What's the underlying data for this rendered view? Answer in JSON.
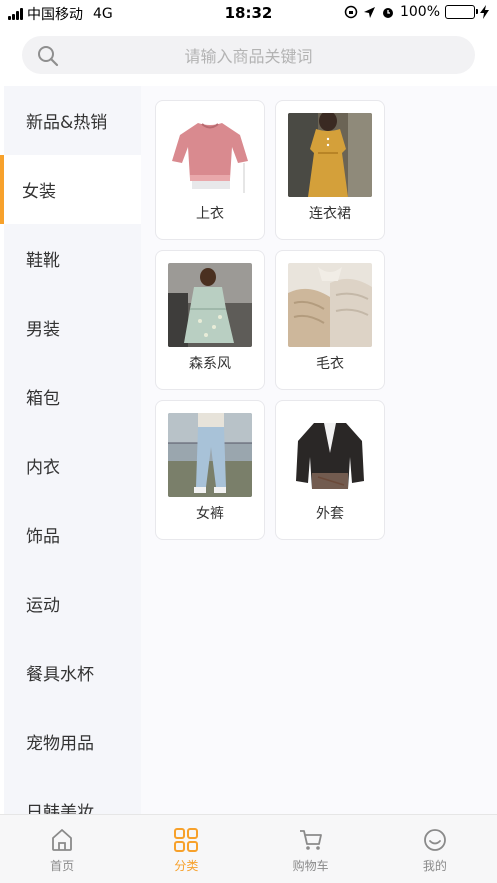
{
  "status_bar": {
    "carrier": "中国移动",
    "network": "4G",
    "time": "18:32",
    "battery": "100%"
  },
  "search": {
    "placeholder": "请输入商品关键词"
  },
  "sidebar": {
    "items": [
      {
        "label": "新品&热销"
      },
      {
        "label": "女装"
      },
      {
        "label": "鞋靴"
      },
      {
        "label": "男装"
      },
      {
        "label": "箱包"
      },
      {
        "label": "内衣"
      },
      {
        "label": "饰品"
      },
      {
        "label": "运动"
      },
      {
        "label": "餐具水杯"
      },
      {
        "label": "宠物用品"
      },
      {
        "label": "日韩美妆"
      }
    ],
    "active_index": 1
  },
  "categories": {
    "items": [
      {
        "label": "上衣",
        "image": "pink-sweater"
      },
      {
        "label": "连衣裙",
        "image": "mustard-dress"
      },
      {
        "label": "森系风",
        "image": "floral-dress-model"
      },
      {
        "label": "毛衣",
        "image": "knit-sweaters"
      },
      {
        "label": "女裤",
        "image": "jeans-model"
      },
      {
        "label": "外套",
        "image": "black-jacket"
      }
    ]
  },
  "tabbar": {
    "tabs": [
      {
        "label": "首页",
        "icon": "home-icon"
      },
      {
        "label": "分类",
        "icon": "category-icon"
      },
      {
        "label": "购物车",
        "icon": "cart-icon"
      },
      {
        "label": "我的",
        "icon": "profile-icon"
      }
    ],
    "active_index": 1
  },
  "colors": {
    "accent": "#f7a12b",
    "sidebar_bg": "#f5f6fa",
    "battery": "#4cd964"
  }
}
